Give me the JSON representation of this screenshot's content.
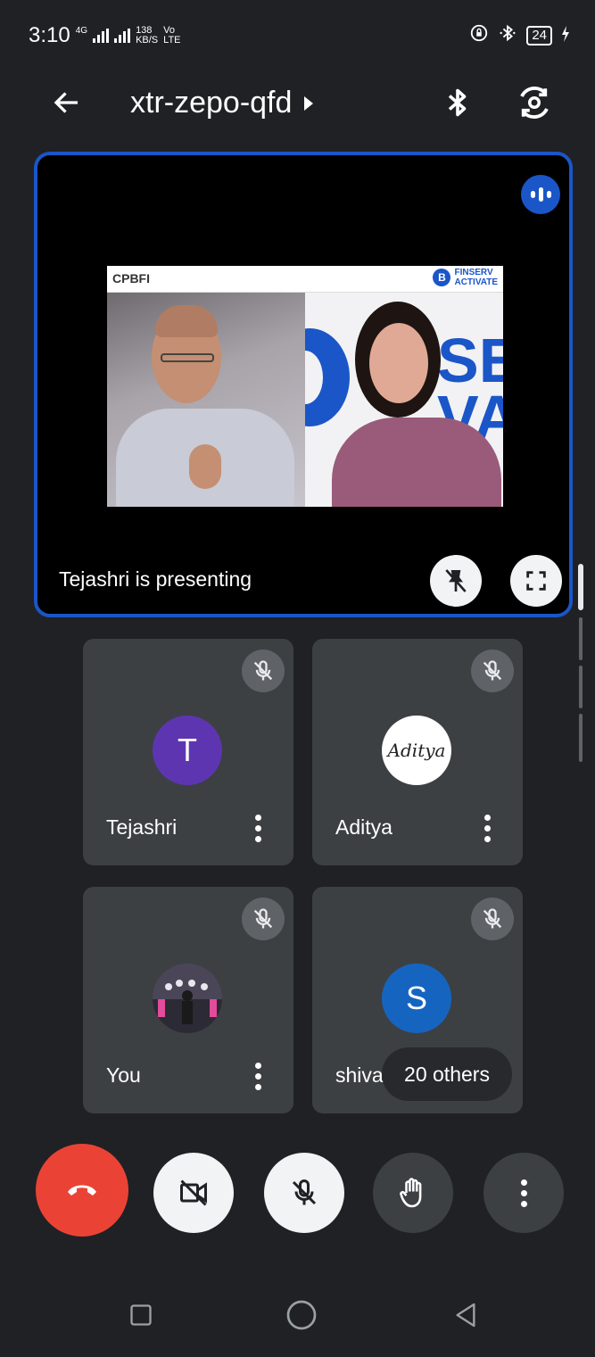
{
  "status_bar": {
    "time": "3:10",
    "network_tag": "4G",
    "speed_value": "138",
    "speed_unit": "KB/S",
    "volte_top": "Vo",
    "volte_bottom": "LTE",
    "battery": "24"
  },
  "app_bar": {
    "meeting_code": "xtr-zepo-qfd",
    "icons": [
      "back-arrow-icon",
      "bluetooth-icon",
      "switch-camera-icon"
    ]
  },
  "presentation": {
    "presenting_label": "Tejashri is presenting",
    "slide_brand": "CPBFI",
    "slide_logo_mark": "B",
    "slide_logo_line1": "FINSERV",
    "slide_logo_line2": "ACTIVATE",
    "slide_bg_text_1": "SE",
    "slide_bg_text_2": "VA",
    "accent_color": "#1a56c8"
  },
  "participants": [
    {
      "name": "Tejashri",
      "initial": "T",
      "avatar_color": "#5e35b1",
      "muted": true
    },
    {
      "name": "Aditya",
      "avatar_text": "Aditya",
      "avatar_color": "#ffffff",
      "muted": true
    },
    {
      "name": "You",
      "avatar_color": "#3a3a4a",
      "muted": true
    },
    {
      "name": "shivan",
      "initial": "S",
      "avatar_color": "#1565c0",
      "muted": true
    }
  ],
  "others_chip": "20 others",
  "controls": {
    "end_call_color": "#ea4335",
    "buttons": [
      "end-call-icon",
      "camera-off-icon",
      "mic-off-icon",
      "raise-hand-icon",
      "more-options-icon"
    ]
  },
  "nav_bar": [
    "recents-icon",
    "home-icon",
    "back-icon"
  ]
}
